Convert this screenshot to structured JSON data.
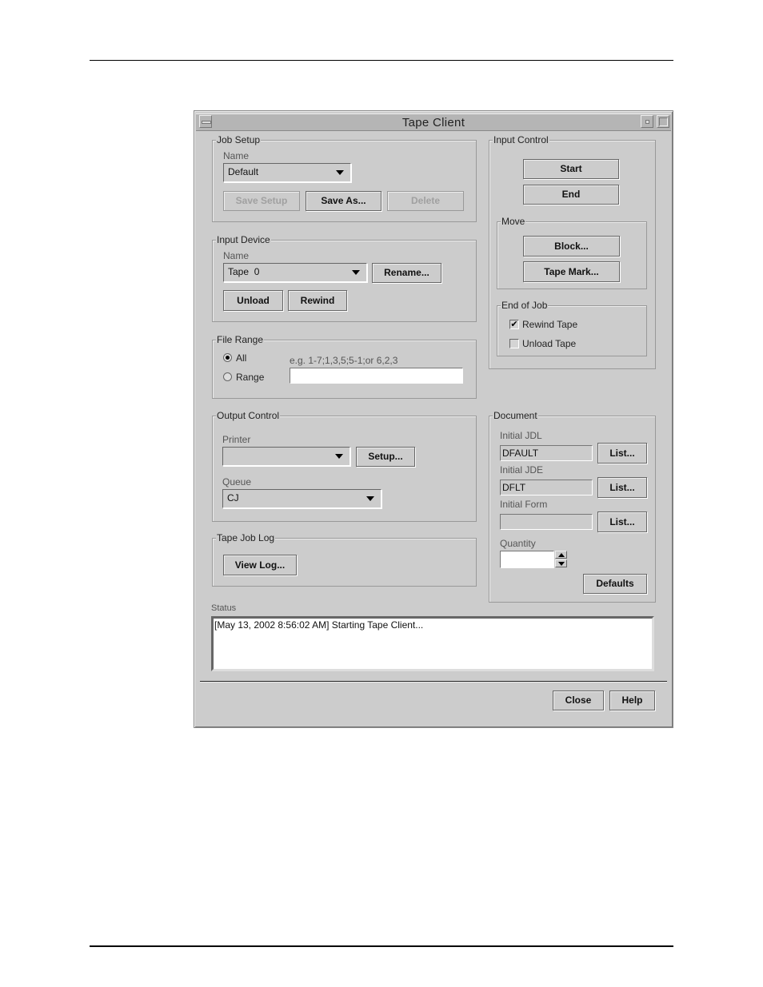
{
  "window": {
    "title": "Tape Client"
  },
  "job_setup": {
    "title": "Job Setup",
    "name_label": "Name",
    "name_value": "Default",
    "save_setup": "Save Setup",
    "save_as": "Save As...",
    "delete": "Delete"
  },
  "input_device": {
    "title": "Input Device",
    "name_label": "Name",
    "name_value": "Tape  0",
    "rename": "Rename...",
    "unload": "Unload",
    "rewind": "Rewind"
  },
  "file_range": {
    "title": "File Range",
    "all_label": "All",
    "range_label": "Range",
    "hint": "e.g. 1-7;1,3,5;5-1;or 6,2,3",
    "range_value": "",
    "selected": "All"
  },
  "output_control": {
    "title": "Output Control",
    "printer_label": "Printer",
    "printer_value": "",
    "setup": "Setup...",
    "queue_label": "Queue",
    "queue_value": "CJ"
  },
  "tape_job_log": {
    "title": "Tape Job Log",
    "view_log": "View Log..."
  },
  "input_control": {
    "title": "Input Control",
    "start": "Start",
    "end": "End",
    "move": {
      "title": "Move",
      "block": "Block...",
      "tape_mark": "Tape Mark..."
    },
    "end_of_job": {
      "title": "End of Job",
      "rewind_tape": {
        "label": "Rewind Tape",
        "checked": true,
        "mark": "✔"
      },
      "unload_tape": {
        "label": "Unload Tape",
        "checked": false,
        "mark": ""
      }
    }
  },
  "document": {
    "title": "Document",
    "initial_jdl_label": "Initial JDL",
    "initial_jdl_value": "DFAULT",
    "initial_jde_label": "Initial JDE",
    "initial_jde_value": "DFLT",
    "initial_form_label": "Initial Form",
    "initial_form_value": "",
    "list": "List...",
    "quantity_label": "Quantity",
    "quantity_value": "",
    "defaults": "Defaults"
  },
  "status": {
    "label": "Status",
    "text": "[May 13, 2002 8:56:02 AM] Starting Tape Client..."
  },
  "footer": {
    "close": "Close",
    "help": "Help"
  }
}
